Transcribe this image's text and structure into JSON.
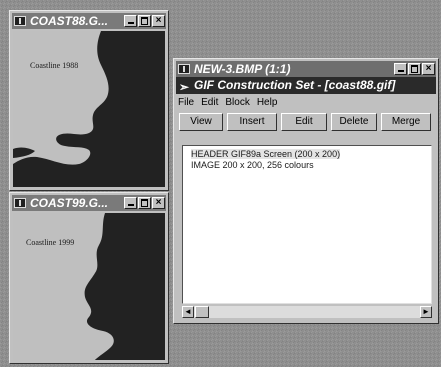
{
  "windows": {
    "coast88": {
      "title": "COAST88.G...",
      "map_label": "Coastline 1988"
    },
    "coast99": {
      "title": "COAST99.G...",
      "map_label": "Coastline 1999"
    },
    "bmp": {
      "title": "NEW-3.BMP (1:1)",
      "app_title": "GIF Construction Set - [coast88.gif]",
      "menu": [
        "File",
        "Edit",
        "Block",
        "Help"
      ],
      "toolbar": [
        "View",
        "Insert",
        "Edit",
        "Delete",
        "Merge"
      ],
      "list_items": [
        "HEADER GIF89a Screen (200 x 200)",
        "IMAGE 200 x 200, 256 colours"
      ]
    }
  },
  "titlebar_buttons": {
    "close": "×"
  },
  "icons": {
    "system_menu": "window-system-icon",
    "app": "gif-construction-set-icon",
    "scroll_left": "◄",
    "scroll_right": "►"
  },
  "colors": {
    "title_inactive": "#7a7a7a",
    "title_active": "#2a2a2a",
    "window_face": "#c0c0c0",
    "land": "#222222",
    "water": "#bfbfbf"
  }
}
